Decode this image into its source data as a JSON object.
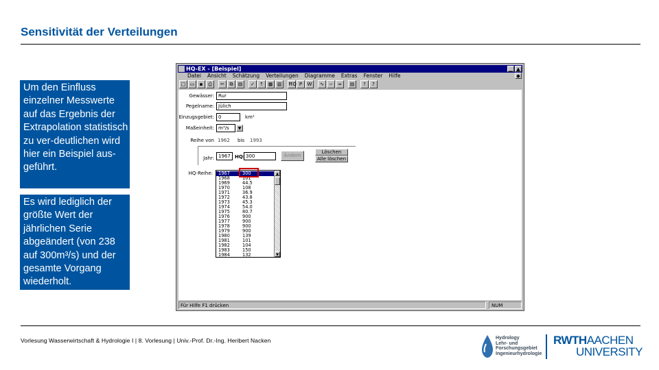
{
  "slide": {
    "title": "Sensitivität der Verteilungen",
    "box1": "Um den Einfluss einzelner Messwerte auf das Ergebnis der Extrapolation statistisch zu ver-deutlichen wird hier ein Beispiel aus-geführt.",
    "box2": "Es wird lediglich der größte Wert der jährlichen Serie abgeändert (von 238 auf 300m³/s) und der gesamte Vorgang wiederholt.",
    "footer": "Vorlesung Wasserwirtschaft & Hydrologie I | 8. Vorlesung | Univ.-Prof. Dr.-Ing. Heribert Nacken",
    "logo_hydrology": [
      "Hydrology",
      "Lehr- und",
      "Forschungsgebiet",
      "Ingenieurhydrologie"
    ],
    "logo_rwth": {
      "rwth": "RWTH",
      "aachen": "AACHEN",
      "university": "UNIVERSITY"
    },
    "colors": {
      "rwth_blue": "#00549f",
      "highlight_red": "#d00000",
      "win_title": "#000080"
    }
  },
  "app": {
    "title": "HQ-EX - [Beispiel]",
    "menu": [
      "Datei",
      "Ansicht",
      "Schätzung",
      "Verteilungen",
      "Diagramme",
      "Extras",
      "Fenster",
      "Hilfe"
    ],
    "toolbar_icons": [
      "new-icon",
      "open-icon",
      "save-icon",
      "print-icon",
      "cut-icon",
      "copy-icon",
      "paste-icon",
      "check-icon",
      "calc-icon",
      "table-icon",
      "chart-icon",
      "hq-icon",
      "p-icon",
      "w-icon",
      "curve1-icon",
      "curve2-icon",
      "curve3-icon",
      "doc-icon",
      "help-icon",
      "whatsthis-icon"
    ],
    "toolbar_glyphs": [
      "□",
      "▭",
      "▪",
      "⎙",
      "✂",
      "⧉",
      "▤",
      "✓",
      "↑",
      "▦",
      "▥",
      "ĦQ",
      "P",
      "W",
      "∿",
      "∽",
      "≈",
      "▤",
      "?",
      "?"
    ],
    "form": {
      "gewaesser_label": "Gewässer:",
      "gewaesser_value": "Rur",
      "pegelname_label": "Pegelname:",
      "pegelname_value": "Jülich",
      "einzugsgebiet_label": "Einzugsgebiet:",
      "einzugsgebiet_value": "0",
      "einzugsgebiet_unit": "km²",
      "masseinheit_label": "Maßeinheit:",
      "masseinheit_value": "m³/s",
      "reihe_label": "Reihe von",
      "reihe_von": "1962",
      "reihe_bis_label": "bis",
      "reihe_bis": "1993",
      "jahr_label": "Jahr:",
      "jahr_value": "1967",
      "hq_label": "HQ:",
      "hq_value": "300",
      "aendern_button": "Ändern",
      "loeschen_button": "Löschen",
      "alle_loeschen_button": "Alle löschen",
      "hq_reihe_label": "HQ-Reihe:"
    },
    "hq_list": [
      {
        "year": "1967",
        "value": "300"
      },
      {
        "year": "1968",
        "value": "101"
      },
      {
        "year": "1969",
        "value": "44.5"
      },
      {
        "year": "1970",
        "value": "108"
      },
      {
        "year": "1971",
        "value": "36.9"
      },
      {
        "year": "1972",
        "value": "43.8"
      },
      {
        "year": "1973",
        "value": "45.3"
      },
      {
        "year": "1974",
        "value": "54.0"
      },
      {
        "year": "1975",
        "value": "80.7"
      },
      {
        "year": "1976",
        "value": "900"
      },
      {
        "year": "1977",
        "value": "900"
      },
      {
        "year": "1978",
        "value": "900"
      },
      {
        "year": "1979",
        "value": "900"
      },
      {
        "year": "1980",
        "value": "139"
      },
      {
        "year": "1981",
        "value": "101"
      },
      {
        "year": "1982",
        "value": "104"
      },
      {
        "year": "1983",
        "value": "150"
      },
      {
        "year": "1984",
        "value": "132"
      }
    ],
    "status": {
      "left": "Für Hilfe F1 drücken",
      "right": "NUM"
    }
  }
}
